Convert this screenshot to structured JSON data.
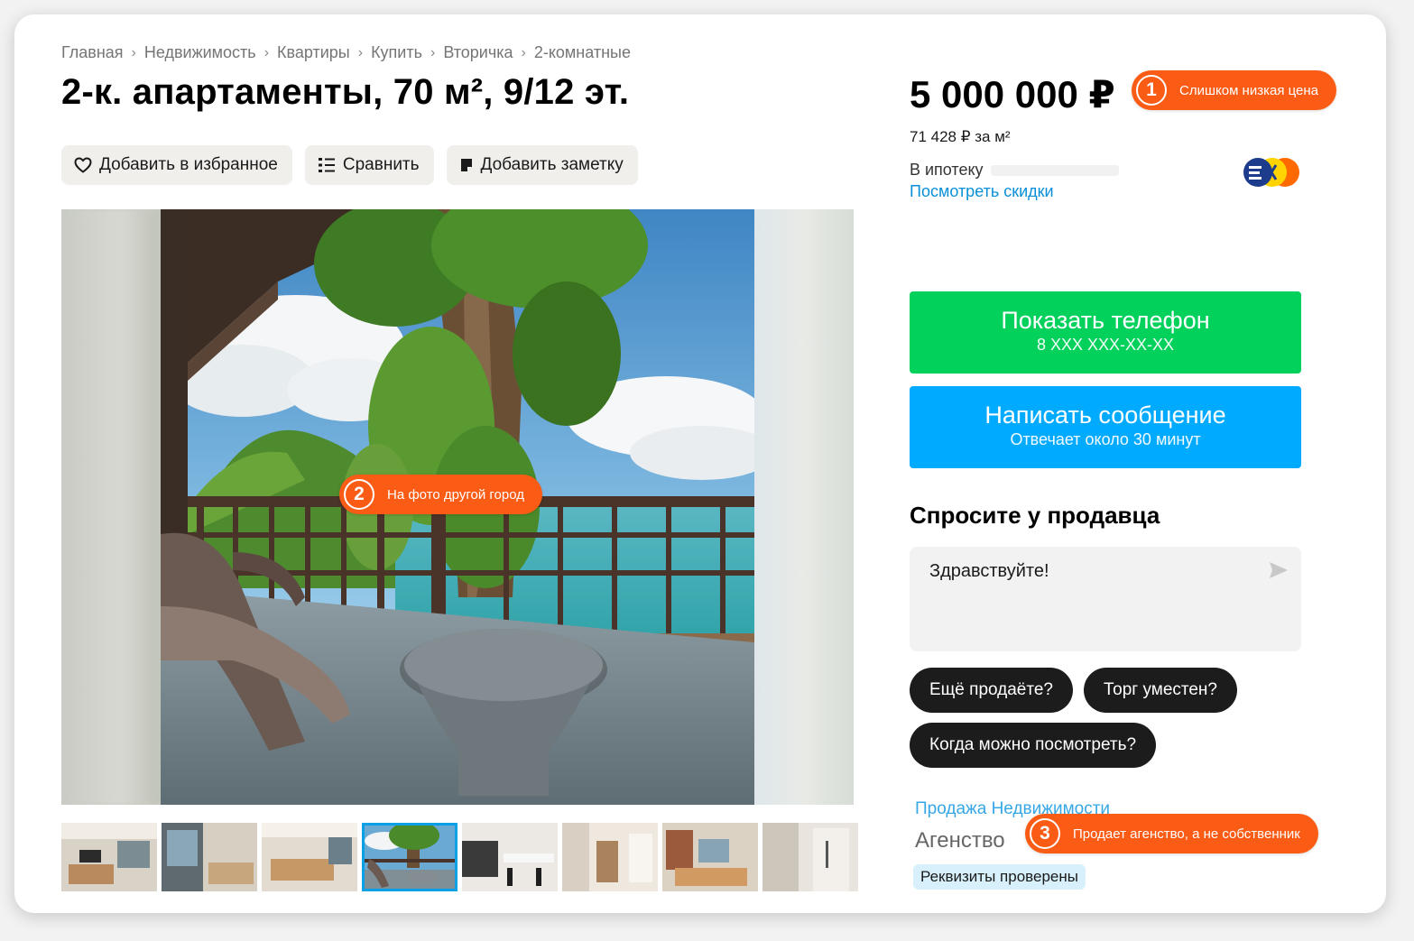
{
  "breadcrumb": {
    "items": [
      "Главная",
      "Недвижимость",
      "Квартиры",
      "Купить",
      "Вторичка",
      "2-комнатные"
    ]
  },
  "listing": {
    "title": "2-к. апартаменты, 70 м², 9/12 эт.",
    "price": "5 000 000 ₽",
    "price_per_m2": "71 428 ₽ за м²",
    "mortgage_label": "В ипотеку",
    "discounts_link": "Посмотреть скидки"
  },
  "actions": {
    "favorite": "Добавить в избранное",
    "compare": "Сравнить",
    "note": "Добавить заметку"
  },
  "gallery": {
    "thumbnail_count": 8,
    "active_thumbnail": 4
  },
  "contact": {
    "phone_button": "Показать телефон",
    "phone_masked": "8 XXX XXX-XX-XX",
    "message_button": "Написать сообщение",
    "message_sub": "Отвечает около 30 минут"
  },
  "ask": {
    "title": "Спросите у продавца",
    "message_value": "Здравствуйте!",
    "chips": [
      "Ещё продаёте?",
      "Торг уместен?",
      "Когда можно посмотреть?"
    ]
  },
  "seller": {
    "name": "Продажа Недвижимости",
    "type": "Агенство",
    "verified": "Реквизиты проверены"
  },
  "annotations": [
    {
      "number": "1",
      "text": "Слишком низкая цена"
    },
    {
      "number": "2",
      "text": "На фото другой город"
    },
    {
      "number": "3",
      "text": "Продает агенство, а не собственник"
    }
  ],
  "colors": {
    "accent_orange": "#fa5c15",
    "phone_green": "#02d15c",
    "message_blue": "#00aaff",
    "link_blue": "#0a8fd8"
  }
}
